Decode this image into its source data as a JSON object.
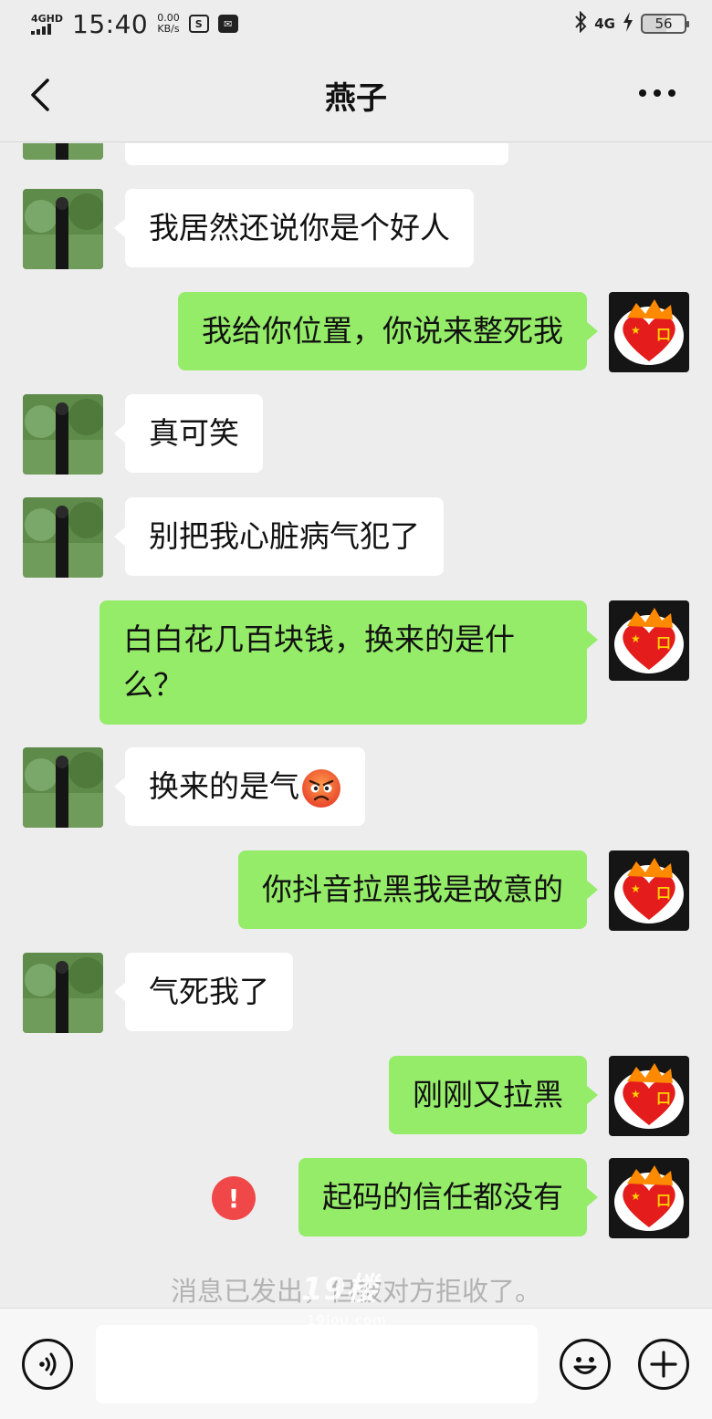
{
  "status_bar": {
    "network": "4GHD",
    "time": "15:40",
    "speed_value": "0.00",
    "speed_unit": "KB/s",
    "network_right": "4G",
    "battery": "56"
  },
  "header": {
    "title": "燕子"
  },
  "messages": [
    {
      "side": "left",
      "text": "我居然还说你是个好人"
    },
    {
      "side": "right",
      "text": "我给你位置，你说来整死我"
    },
    {
      "side": "left",
      "text": "真可笑"
    },
    {
      "side": "left",
      "text": "别把我心脏病气犯了"
    },
    {
      "side": "right",
      "text_line1": "白白花几百块钱，换来的是什",
      "text_line2": "么？"
    },
    {
      "side": "left",
      "text": "换来的是气",
      "emoji": "angry-face-icon"
    },
    {
      "side": "right",
      "text": "你抖音拉黑我是故意的"
    },
    {
      "side": "left",
      "text": "气死我了"
    },
    {
      "side": "right",
      "text": "刚刚又拉黑"
    },
    {
      "side": "right",
      "text": "起码的信任都没有",
      "status": "failed"
    }
  ],
  "system_notice": "消息已发出，但被对方拒收了。",
  "watermark": {
    "main": "19楼",
    "sub": "19lou.com"
  },
  "error_mark": "!",
  "colors": {
    "background": "#ededed",
    "incoming_bubble": "#ffffff",
    "outgoing_bubble": "#95ec69",
    "error": "#f04848"
  },
  "icons": {
    "back": "chevron-left-icon",
    "more": "more-dots-icon",
    "voice": "voice-icon",
    "emoji": "emoji-icon",
    "plus": "plus-icon"
  }
}
